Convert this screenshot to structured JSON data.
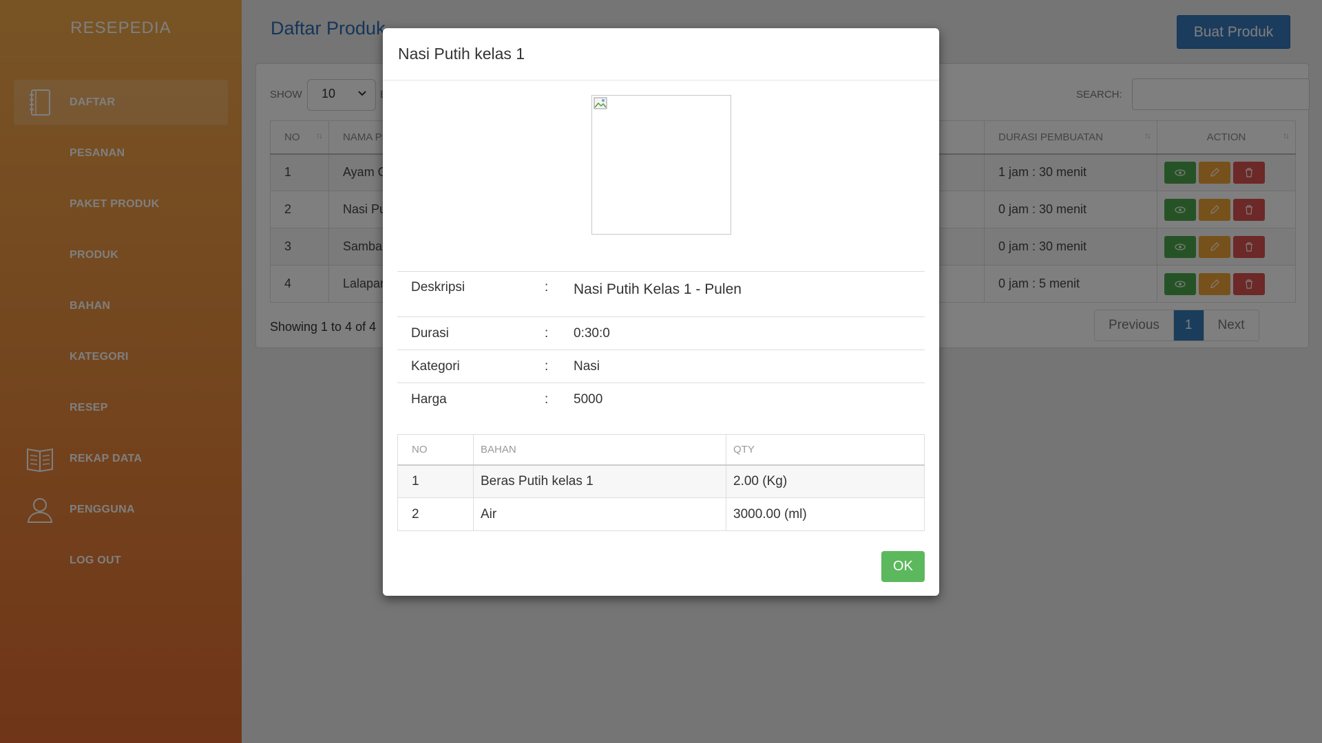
{
  "sidebar": {
    "brand": "RESEPEDIA",
    "items": [
      {
        "label": "DAFTAR",
        "icon": "notebook-icon"
      },
      {
        "label": "PESANAN"
      },
      {
        "label": "PAKET PRODUK"
      },
      {
        "label": "PRODUK"
      },
      {
        "label": "BAHAN"
      },
      {
        "label": "KATEGORI"
      },
      {
        "label": "RESEP"
      },
      {
        "label": "REKAP DATA",
        "icon": "book-icon"
      },
      {
        "label": "PENGGUNA",
        "icon": "user-icon"
      },
      {
        "label": "LOG OUT"
      }
    ]
  },
  "main": {
    "title": "Daftar Produk",
    "create_label": "Buat Produk",
    "show_label": "SHOW",
    "show_value": "10",
    "entries_label": "E",
    "search_label": "SEARCH:",
    "columns": {
      "no": "NO",
      "name": "NAMA PR",
      "duration": "DURASI PEMBUATAN",
      "action": "ACTION"
    },
    "rows": [
      {
        "no": "1",
        "name": "Ayam G",
        "duration": "1 jam : 30 menit"
      },
      {
        "no": "2",
        "name": "Nasi Pu",
        "duration": "0 jam : 30 menit"
      },
      {
        "no": "3",
        "name": "Sambal",
        "duration": "0 jam : 30 menit"
      },
      {
        "no": "4",
        "name": "Lalapan",
        "duration": "0 jam : 5 menit"
      }
    ],
    "showing_text": "Showing 1 to 4 of 4",
    "pager": {
      "prev": "Previous",
      "current": "1",
      "next": "Next"
    }
  },
  "modal": {
    "title": "Nasi Putih kelas 1",
    "info": [
      {
        "key": "Deskripsi",
        "colon": ":",
        "value": "Nasi Putih Kelas 1 - Pulen"
      },
      {
        "key": "Durasi",
        "colon": ":",
        "value": "0:30:0"
      },
      {
        "key": "Kategori",
        "colon": ":",
        "value": "Nasi"
      },
      {
        "key": "Harga",
        "colon": ":",
        "value": "5000"
      }
    ],
    "items_columns": {
      "no": "NO",
      "bahan": "BAHAN",
      "qty": "QTY"
    },
    "items": [
      {
        "no": "1",
        "bahan": "Beras Putih kelas 1",
        "qty": "2.00 (Kg)"
      },
      {
        "no": "2",
        "bahan": "Air",
        "qty": "3000.00 (ml)"
      }
    ],
    "ok_label": "OK"
  },
  "colors": {
    "sidebar_top": "#f0a84a",
    "sidebar_bottom": "#e06b30",
    "primary": "#337ab7",
    "success": "#5cb85c",
    "warning": "#eea236",
    "danger": "#d9534f"
  }
}
